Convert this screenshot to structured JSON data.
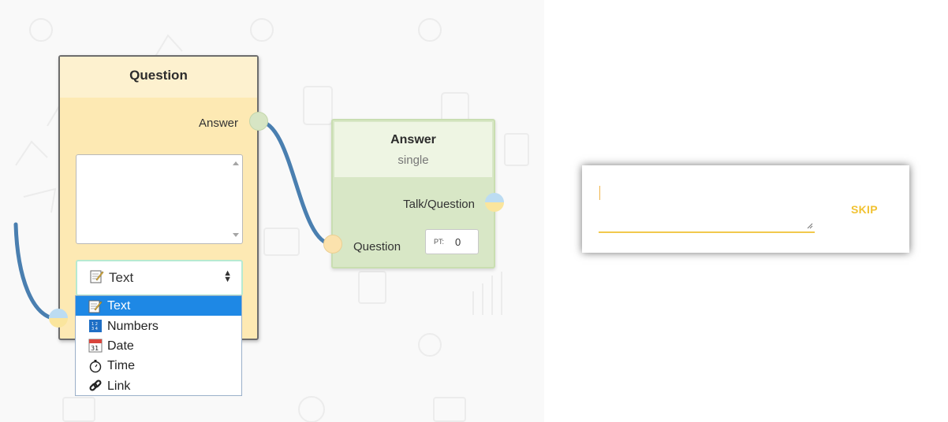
{
  "question_node": {
    "title": "Question",
    "output_label": "Answer",
    "textarea_value": "",
    "type_select": {
      "selected_icon": "📝",
      "selected": "Text"
    },
    "type_options": [
      {
        "icon": "memo-icon",
        "label": "Text",
        "selected": true
      },
      {
        "icon": "numbers-icon",
        "label": "Numbers",
        "selected": false
      },
      {
        "icon": "calendar-icon",
        "label": "Date",
        "selected": false
      },
      {
        "icon": "stopwatch-icon",
        "label": "Time",
        "selected": false
      },
      {
        "icon": "link-icon",
        "label": "Link",
        "selected": false
      }
    ]
  },
  "answer_node": {
    "title": "Answer",
    "subtitle": "single",
    "output_label": "Talk/Question",
    "input_label": "Question",
    "points_label": "PT:",
    "points_value": "0"
  },
  "answer_panel": {
    "input_value": "",
    "skip_label": "SKIP"
  },
  "colors": {
    "question_node_bg": "#fde9b3",
    "answer_node_bg": "#d8e7c6",
    "wire": "#4a7fb0",
    "selected_option": "#1e88e5",
    "accent_yellow": "#f1c232"
  }
}
